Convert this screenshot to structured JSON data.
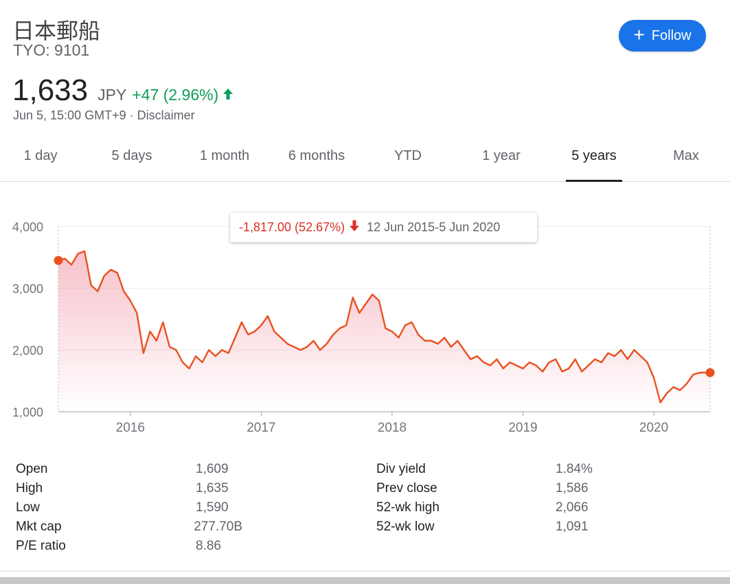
{
  "header": {
    "name": "日本郵船",
    "ticker": "TYO: 9101",
    "follow_label": "Follow"
  },
  "quote": {
    "price": "1,633",
    "currency": "JPY",
    "change": "+47 (2.96%)",
    "timestamp": "Jun 5, 15:00 GMT+9 · Disclaimer"
  },
  "tabs": [
    {
      "label": "1 day"
    },
    {
      "label": "5 days"
    },
    {
      "label": "1 month"
    },
    {
      "label": "6 months"
    },
    {
      "label": "YTD"
    },
    {
      "label": "1 year"
    },
    {
      "label": "5 years",
      "active": true
    },
    {
      "label": "Max"
    }
  ],
  "tooltip": {
    "change": "-1,817.00 (52.67%)",
    "range": "12 Jun 2015-5 Jun 2020"
  },
  "colors": {
    "accent": "#1a73e8",
    "up": "#0f9d58",
    "down": "#d93025",
    "line": "#e8501f"
  },
  "chart_data": {
    "type": "area",
    "xlim": [
      2015.45,
      2020.43
    ],
    "ylim": [
      1000,
      4000
    ],
    "y_ticks": [
      "1,000",
      "2,000",
      "3,000",
      "4,000"
    ],
    "x_ticks": [
      "2016",
      "2017",
      "2018",
      "2019",
      "2020"
    ],
    "x": [
      2015.45,
      2015.5,
      2015.55,
      2015.6,
      2015.65,
      2015.7,
      2015.75,
      2015.8,
      2015.85,
      2015.9,
      2015.95,
      2016.0,
      2016.05,
      2016.1,
      2016.15,
      2016.2,
      2016.25,
      2016.3,
      2016.35,
      2016.4,
      2016.45,
      2016.5,
      2016.55,
      2016.6,
      2016.65,
      2016.7,
      2016.75,
      2016.8,
      2016.85,
      2016.9,
      2016.95,
      2017.0,
      2017.05,
      2017.1,
      2017.15,
      2017.2,
      2017.25,
      2017.3,
      2017.35,
      2017.4,
      2017.45,
      2017.5,
      2017.55,
      2017.6,
      2017.65,
      2017.7,
      2017.75,
      2017.8,
      2017.85,
      2017.9,
      2017.95,
      2018.0,
      2018.05,
      2018.1,
      2018.15,
      2018.2,
      2018.25,
      2018.3,
      2018.35,
      2018.4,
      2018.45,
      2018.5,
      2018.55,
      2018.6,
      2018.65,
      2018.7,
      2018.75,
      2018.8,
      2018.85,
      2018.9,
      2018.95,
      2019.0,
      2019.05,
      2019.1,
      2019.15,
      2019.2,
      2019.25,
      2019.3,
      2019.35,
      2019.4,
      2019.45,
      2019.5,
      2019.55,
      2019.6,
      2019.65,
      2019.7,
      2019.75,
      2019.8,
      2019.85,
      2019.9,
      2019.95,
      2020.0,
      2020.05,
      2020.1,
      2020.15,
      2020.2,
      2020.25,
      2020.3,
      2020.35,
      2020.4,
      2020.43
    ],
    "y": [
      3450,
      3480,
      3380,
      3560,
      3600,
      3050,
      2950,
      3200,
      3300,
      3250,
      2950,
      2800,
      2600,
      1950,
      2300,
      2150,
      2450,
      2050,
      2000,
      1800,
      1700,
      1900,
      1800,
      2000,
      1900,
      2000,
      1950,
      2200,
      2450,
      2250,
      2300,
      2400,
      2550,
      2300,
      2200,
      2100,
      2050,
      2000,
      2050,
      2150,
      2000,
      2100,
      2250,
      2350,
      2400,
      2850,
      2600,
      2750,
      2900,
      2800,
      2350,
      2300,
      2200,
      2400,
      2450,
      2250,
      2150,
      2150,
      2100,
      2200,
      2050,
      2150,
      2000,
      1850,
      1900,
      1800,
      1750,
      1850,
      1700,
      1800,
      1750,
      1700,
      1800,
      1750,
      1650,
      1800,
      1850,
      1650,
      1700,
      1850,
      1650,
      1750,
      1850,
      1800,
      1950,
      1900,
      2000,
      1850,
      2000,
      1900,
      1800,
      1550,
      1150,
      1300,
      1400,
      1350,
      1450,
      1600,
      1633,
      1633,
      1633
    ]
  },
  "stats": {
    "left": [
      {
        "key": "Open",
        "value": "1,609"
      },
      {
        "key": "High",
        "value": "1,635"
      },
      {
        "key": "Low",
        "value": "1,590"
      },
      {
        "key": "Mkt cap",
        "value": "277.70B"
      },
      {
        "key": "P/E ratio",
        "value": "8.86"
      }
    ],
    "right": [
      {
        "key": "Div yield",
        "value": "1.84%"
      },
      {
        "key": "Prev close",
        "value": "1,586"
      },
      {
        "key": "52-wk high",
        "value": "2,066"
      },
      {
        "key": "52-wk low",
        "value": "1,091"
      }
    ]
  }
}
